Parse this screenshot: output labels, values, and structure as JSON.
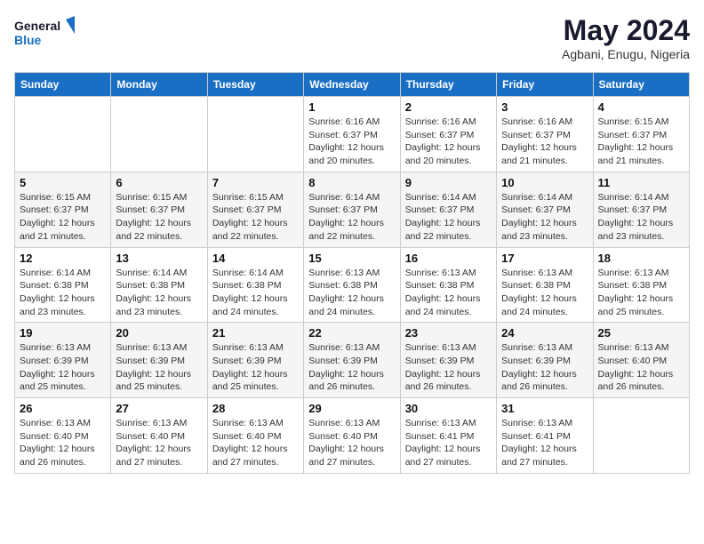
{
  "logo": {
    "line1": "General",
    "line2": "Blue"
  },
  "title": "May 2024",
  "location": "Agbani, Enugu, Nigeria",
  "weekdays": [
    "Sunday",
    "Monday",
    "Tuesday",
    "Wednesday",
    "Thursday",
    "Friday",
    "Saturday"
  ],
  "weeks": [
    [
      {
        "day": "",
        "info": ""
      },
      {
        "day": "",
        "info": ""
      },
      {
        "day": "",
        "info": ""
      },
      {
        "day": "1",
        "info": "Sunrise: 6:16 AM\nSunset: 6:37 PM\nDaylight: 12 hours\nand 20 minutes."
      },
      {
        "day": "2",
        "info": "Sunrise: 6:16 AM\nSunset: 6:37 PM\nDaylight: 12 hours\nand 20 minutes."
      },
      {
        "day": "3",
        "info": "Sunrise: 6:16 AM\nSunset: 6:37 PM\nDaylight: 12 hours\nand 21 minutes."
      },
      {
        "day": "4",
        "info": "Sunrise: 6:15 AM\nSunset: 6:37 PM\nDaylight: 12 hours\nand 21 minutes."
      }
    ],
    [
      {
        "day": "5",
        "info": "Sunrise: 6:15 AM\nSunset: 6:37 PM\nDaylight: 12 hours\nand 21 minutes."
      },
      {
        "day": "6",
        "info": "Sunrise: 6:15 AM\nSunset: 6:37 PM\nDaylight: 12 hours\nand 22 minutes."
      },
      {
        "day": "7",
        "info": "Sunrise: 6:15 AM\nSunset: 6:37 PM\nDaylight: 12 hours\nand 22 minutes."
      },
      {
        "day": "8",
        "info": "Sunrise: 6:14 AM\nSunset: 6:37 PM\nDaylight: 12 hours\nand 22 minutes."
      },
      {
        "day": "9",
        "info": "Sunrise: 6:14 AM\nSunset: 6:37 PM\nDaylight: 12 hours\nand 22 minutes."
      },
      {
        "day": "10",
        "info": "Sunrise: 6:14 AM\nSunset: 6:37 PM\nDaylight: 12 hours\nand 23 minutes."
      },
      {
        "day": "11",
        "info": "Sunrise: 6:14 AM\nSunset: 6:37 PM\nDaylight: 12 hours\nand 23 minutes."
      }
    ],
    [
      {
        "day": "12",
        "info": "Sunrise: 6:14 AM\nSunset: 6:38 PM\nDaylight: 12 hours\nand 23 minutes."
      },
      {
        "day": "13",
        "info": "Sunrise: 6:14 AM\nSunset: 6:38 PM\nDaylight: 12 hours\nand 23 minutes."
      },
      {
        "day": "14",
        "info": "Sunrise: 6:14 AM\nSunset: 6:38 PM\nDaylight: 12 hours\nand 24 minutes."
      },
      {
        "day": "15",
        "info": "Sunrise: 6:13 AM\nSunset: 6:38 PM\nDaylight: 12 hours\nand 24 minutes."
      },
      {
        "day": "16",
        "info": "Sunrise: 6:13 AM\nSunset: 6:38 PM\nDaylight: 12 hours\nand 24 minutes."
      },
      {
        "day": "17",
        "info": "Sunrise: 6:13 AM\nSunset: 6:38 PM\nDaylight: 12 hours\nand 24 minutes."
      },
      {
        "day": "18",
        "info": "Sunrise: 6:13 AM\nSunset: 6:38 PM\nDaylight: 12 hours\nand 25 minutes."
      }
    ],
    [
      {
        "day": "19",
        "info": "Sunrise: 6:13 AM\nSunset: 6:39 PM\nDaylight: 12 hours\nand 25 minutes."
      },
      {
        "day": "20",
        "info": "Sunrise: 6:13 AM\nSunset: 6:39 PM\nDaylight: 12 hours\nand 25 minutes."
      },
      {
        "day": "21",
        "info": "Sunrise: 6:13 AM\nSunset: 6:39 PM\nDaylight: 12 hours\nand 25 minutes."
      },
      {
        "day": "22",
        "info": "Sunrise: 6:13 AM\nSunset: 6:39 PM\nDaylight: 12 hours\nand 26 minutes."
      },
      {
        "day": "23",
        "info": "Sunrise: 6:13 AM\nSunset: 6:39 PM\nDaylight: 12 hours\nand 26 minutes."
      },
      {
        "day": "24",
        "info": "Sunrise: 6:13 AM\nSunset: 6:39 PM\nDaylight: 12 hours\nand 26 minutes."
      },
      {
        "day": "25",
        "info": "Sunrise: 6:13 AM\nSunset: 6:40 PM\nDaylight: 12 hours\nand 26 minutes."
      }
    ],
    [
      {
        "day": "26",
        "info": "Sunrise: 6:13 AM\nSunset: 6:40 PM\nDaylight: 12 hours\nand 26 minutes."
      },
      {
        "day": "27",
        "info": "Sunrise: 6:13 AM\nSunset: 6:40 PM\nDaylight: 12 hours\nand 27 minutes."
      },
      {
        "day": "28",
        "info": "Sunrise: 6:13 AM\nSunset: 6:40 PM\nDaylight: 12 hours\nand 27 minutes."
      },
      {
        "day": "29",
        "info": "Sunrise: 6:13 AM\nSunset: 6:40 PM\nDaylight: 12 hours\nand 27 minutes."
      },
      {
        "day": "30",
        "info": "Sunrise: 6:13 AM\nSunset: 6:41 PM\nDaylight: 12 hours\nand 27 minutes."
      },
      {
        "day": "31",
        "info": "Sunrise: 6:13 AM\nSunset: 6:41 PM\nDaylight: 12 hours\nand 27 minutes."
      },
      {
        "day": "",
        "info": ""
      }
    ]
  ]
}
